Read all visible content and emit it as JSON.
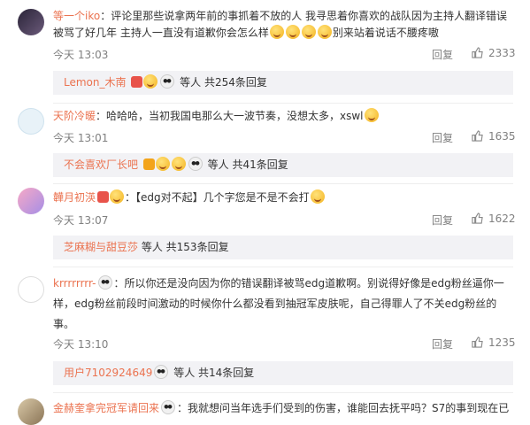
{
  "comments": [
    {
      "user": "等一个iko",
      "text1": "：评论里那些说拿两年前的事抓着不放的人 我寻思着你喜欢的战队因为主持人翻译错误",
      "text2a": "被骂了好几年 主持人一直没有道歉你会怎么样",
      "text2b": "别来站着说话不腰疼嗷",
      "time": "今天 13:03",
      "reply_label": "回复",
      "likes": "2333",
      "sub_user": "Lemon_木南",
      "sub_text": "等人 共254条回复"
    },
    {
      "user": "天阶冷暖",
      "text1": "：哈哈哈，当初我国电那么大一波节奏，没想太多，xswl",
      "time": "今天 13:01",
      "reply_label": "回复",
      "likes": "1635",
      "sub_user": "不会喜欢厂长吧",
      "sub_text": "等人 共41条回复"
    },
    {
      "user": "韡月初渶",
      "text1": "：【edg对不起】几个字您是不是不会打",
      "time": "今天 13:07",
      "reply_label": "回复",
      "likes": "1622",
      "sub_user": "芝麻糊与甜豆莎",
      "sub_text": "等人 共153条回复"
    },
    {
      "user": "krrrrrrrr-",
      "text1": "：所以你还是没向因为你的错误翻译被骂edg道歉啊。别说得好像是edg粉丝逼你一",
      "text2": "样，edg粉丝前段时间激动的时候你什么都没看到抽冠军皮肤呢，自己得罪人了不关edg粉丝的",
      "text3": "事。",
      "time": "今天 13:10",
      "reply_label": "回复",
      "likes": "1235",
      "sub_user": "用户7102924649",
      "sub_text": "等人 共14条回复"
    },
    {
      "user": "金赫奎拿完冠军请回来",
      "text1": "：我就想问当年选手们受到的伤害，谁能回去抚平吗？S7的事到现在已"
    }
  ]
}
